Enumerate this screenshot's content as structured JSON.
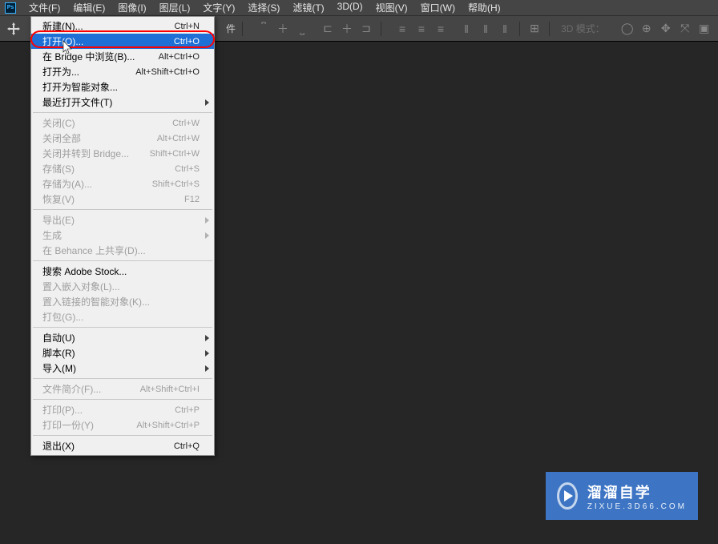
{
  "app_logo": "Ps",
  "menubar": [
    "文件(F)",
    "编辑(E)",
    "图像(I)",
    "图层(L)",
    "文字(Y)",
    "选择(S)",
    "滤镜(T)",
    "3D(D)",
    "视图(V)",
    "窗口(W)",
    "帮助(H)"
  ],
  "optbar": {
    "fragment": "件",
    "mode3d": "3D 模式："
  },
  "dropdown": [
    {
      "label": "新建(N)...",
      "shortcut": "Ctrl+N",
      "type": "item"
    },
    {
      "label": "打开(O)...",
      "shortcut": "Ctrl+O",
      "type": "item",
      "highlight": true
    },
    {
      "label": "在 Bridge 中浏览(B)...",
      "shortcut": "Alt+Ctrl+O",
      "type": "item"
    },
    {
      "label": "打开为...",
      "shortcut": "Alt+Shift+Ctrl+O",
      "type": "item"
    },
    {
      "label": "打开为智能对象...",
      "shortcut": "",
      "type": "item"
    },
    {
      "label": "最近打开文件(T)",
      "shortcut": "",
      "type": "submenu"
    },
    {
      "type": "sep"
    },
    {
      "label": "关闭(C)",
      "shortcut": "Ctrl+W",
      "type": "item",
      "disabled": true
    },
    {
      "label": "关闭全部",
      "shortcut": "Alt+Ctrl+W",
      "type": "item",
      "disabled": true
    },
    {
      "label": "关闭并转到 Bridge...",
      "shortcut": "Shift+Ctrl+W",
      "type": "item",
      "disabled": true
    },
    {
      "label": "存储(S)",
      "shortcut": "Ctrl+S",
      "type": "item",
      "disabled": true
    },
    {
      "label": "存储为(A)...",
      "shortcut": "Shift+Ctrl+S",
      "type": "item",
      "disabled": true
    },
    {
      "label": "恢复(V)",
      "shortcut": "F12",
      "type": "item",
      "disabled": true
    },
    {
      "type": "sep"
    },
    {
      "label": "导出(E)",
      "shortcut": "",
      "type": "submenu",
      "disabled": true
    },
    {
      "label": "生成",
      "shortcut": "",
      "type": "submenu",
      "disabled": true
    },
    {
      "label": "在 Behance 上共享(D)...",
      "shortcut": "",
      "type": "item",
      "disabled": true
    },
    {
      "type": "sep"
    },
    {
      "label": "搜索 Adobe Stock...",
      "shortcut": "",
      "type": "item"
    },
    {
      "label": "置入嵌入对象(L)...",
      "shortcut": "",
      "type": "item",
      "disabled": true
    },
    {
      "label": "置入链接的智能对象(K)...",
      "shortcut": "",
      "type": "item",
      "disabled": true
    },
    {
      "label": "打包(G)...",
      "shortcut": "",
      "type": "item",
      "disabled": true
    },
    {
      "type": "sep"
    },
    {
      "label": "自动(U)",
      "shortcut": "",
      "type": "submenu"
    },
    {
      "label": "脚本(R)",
      "shortcut": "",
      "type": "submenu"
    },
    {
      "label": "导入(M)",
      "shortcut": "",
      "type": "submenu"
    },
    {
      "type": "sep"
    },
    {
      "label": "文件简介(F)...",
      "shortcut": "Alt+Shift+Ctrl+I",
      "type": "item",
      "disabled": true
    },
    {
      "type": "sep"
    },
    {
      "label": "打印(P)...",
      "shortcut": "Ctrl+P",
      "type": "item",
      "disabled": true
    },
    {
      "label": "打印一份(Y)",
      "shortcut": "Alt+Shift+Ctrl+P",
      "type": "item",
      "disabled": true
    },
    {
      "type": "sep"
    },
    {
      "label": "退出(X)",
      "shortcut": "Ctrl+Q",
      "type": "item"
    }
  ],
  "watermark": {
    "line1": "溜溜自学",
    "line2": "ZIXUE.3D66.COM"
  }
}
